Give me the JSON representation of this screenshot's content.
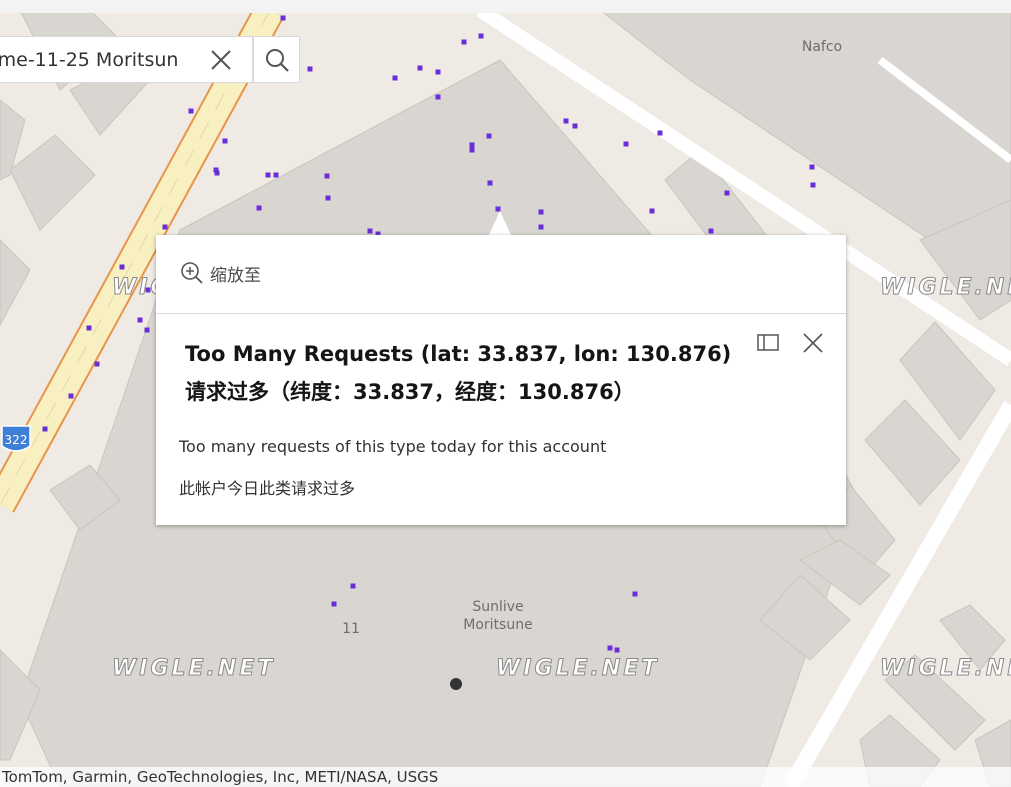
{
  "search": {
    "value": "ome-11-25 Moritsun"
  },
  "map": {
    "labels": {
      "nafco": "Nafco",
      "sunlive_line1": "Sunlive",
      "sunlive_line2": "Moritsune",
      "block_number": "11",
      "route_shield": "322"
    },
    "watermark": "WIGLE.NET",
    "attribution": "TomTom, Garmin, GeoTechnologies, Inc, METI/NASA, USGS",
    "colors": {
      "land": "#efeae3",
      "building": "#d9d5d0",
      "road": "#ffffff",
      "highway_fill": "#f8f0c0",
      "highway_edge": "#e8944a",
      "hotspot": "#6a2ed6",
      "route_shield": "#3d7fd6"
    }
  },
  "popup": {
    "zoom_to_label": "缩放至",
    "title_line1": "Too Many Requests (lat: 33.837, lon: 130.876)",
    "title_line2": "请求过多（纬度：33.837，经度：130.876）",
    "message_en": "Too many requests of this type today for this account",
    "message_zh": "此帐户今日此类请求过多"
  }
}
